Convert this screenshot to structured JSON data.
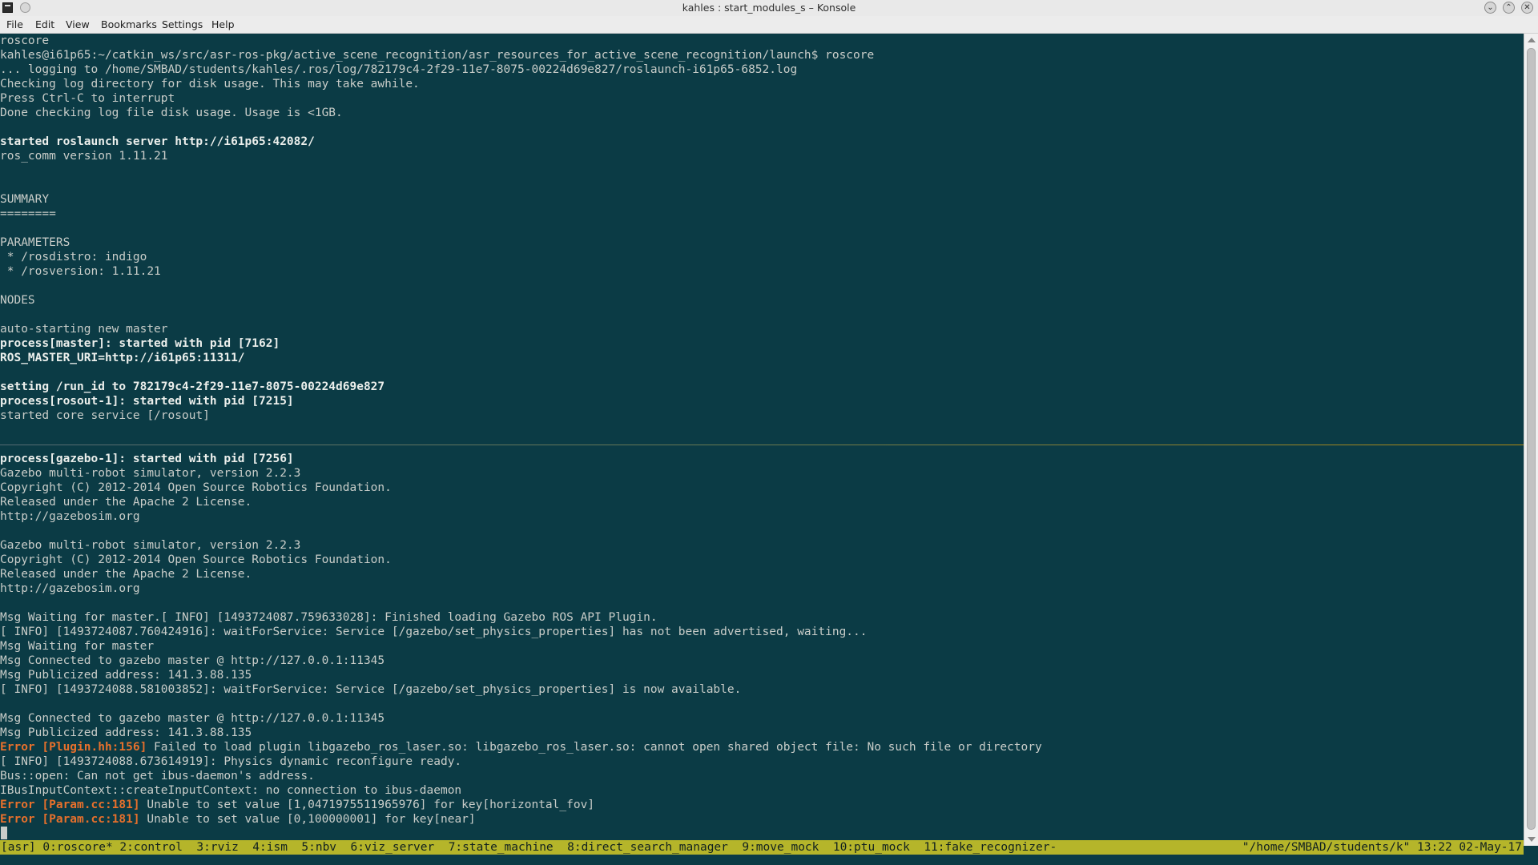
{
  "window": {
    "title": "kahles : start_modules_s – Konsole",
    "controls": {
      "minimize": "⌄",
      "maximize": "⌃",
      "close": "✕"
    }
  },
  "menubar": {
    "items": [
      "File",
      "Edit",
      "View",
      "Bookmarks",
      "Settings",
      "Help"
    ]
  },
  "terminal": {
    "lines": [
      {
        "text": "roscore",
        "style": "normal"
      },
      {
        "text": "kahles@i61p65:~/catkin_ws/src/asr-ros-pkg/active_scene_recognition/asr_resources_for_active_scene_recognition/launch$ roscore",
        "style": "normal"
      },
      {
        "text": "... logging to /home/SMBAD/students/kahles/.ros/log/782179c4-2f29-11e7-8075-00224d69e827/roslaunch-i61p65-6852.log",
        "style": "normal"
      },
      {
        "text": "Checking log directory for disk usage. This may take awhile.",
        "style": "normal"
      },
      {
        "text": "Press Ctrl-C to interrupt",
        "style": "normal"
      },
      {
        "text": "Done checking log file disk usage. Usage is <1GB.",
        "style": "normal"
      },
      {
        "text": "",
        "style": "normal"
      },
      {
        "text": "started roslaunch server http://i61p65:42082/",
        "style": "bold"
      },
      {
        "text": "ros_comm version 1.11.21",
        "style": "normal"
      },
      {
        "text": "",
        "style": "normal"
      },
      {
        "text": "",
        "style": "normal"
      },
      {
        "text": "SUMMARY",
        "style": "normal"
      },
      {
        "text": "========",
        "style": "normal"
      },
      {
        "text": "",
        "style": "normal"
      },
      {
        "text": "PARAMETERS",
        "style": "normal"
      },
      {
        "text": " * /rosdistro: indigo",
        "style": "normal"
      },
      {
        "text": " * /rosversion: 1.11.21",
        "style": "normal"
      },
      {
        "text": "",
        "style": "normal"
      },
      {
        "text": "NODES",
        "style": "normal"
      },
      {
        "text": "",
        "style": "normal"
      },
      {
        "text": "auto-starting new master",
        "style": "normal"
      },
      {
        "text": "process[master]: started with pid [7162]",
        "style": "bold"
      },
      {
        "text": "ROS_MASTER_URI=http://i61p65:11311/",
        "style": "bold"
      },
      {
        "text": "",
        "style": "normal"
      },
      {
        "text": "setting /run_id to 782179c4-2f29-11e7-8075-00224d69e827",
        "style": "bold"
      },
      {
        "text": "process[rosout-1]: started with pid [7215]",
        "style": "bold"
      },
      {
        "text": "started core service [/rosout]",
        "style": "normal"
      },
      {
        "text": "",
        "style": "normal"
      },
      {
        "text": "",
        "style": "normal"
      },
      {
        "text": "process[gazebo-1]: started with pid [7256]",
        "style": "bold"
      },
      {
        "text": "Gazebo multi-robot simulator, version 2.2.3",
        "style": "normal"
      },
      {
        "text": "Copyright (C) 2012-2014 Open Source Robotics Foundation.",
        "style": "normal"
      },
      {
        "text": "Released under the Apache 2 License.",
        "style": "normal"
      },
      {
        "text": "http://gazebosim.org",
        "style": "normal"
      },
      {
        "text": "",
        "style": "normal"
      },
      {
        "text": "Gazebo multi-robot simulator, version 2.2.3",
        "style": "normal"
      },
      {
        "text": "Copyright (C) 2012-2014 Open Source Robotics Foundation.",
        "style": "normal"
      },
      {
        "text": "Released under the Apache 2 License.",
        "style": "normal"
      },
      {
        "text": "http://gazebosim.org",
        "style": "normal"
      },
      {
        "text": "",
        "style": "normal"
      },
      {
        "text": "Msg Waiting for master.[ INFO] [1493724087.759633028]: Finished loading Gazebo ROS API Plugin.",
        "style": "normal"
      },
      {
        "text": "[ INFO] [1493724087.760424916]: waitForService: Service [/gazebo/set_physics_properties] has not been advertised, waiting...",
        "style": "normal"
      },
      {
        "text": "Msg Waiting for master",
        "style": "normal"
      },
      {
        "text": "Msg Connected to gazebo master @ http://127.0.0.1:11345",
        "style": "normal"
      },
      {
        "text": "Msg Publicized address: 141.3.88.135",
        "style": "normal"
      },
      {
        "text": "[ INFO] [1493724088.581003852]: waitForService: Service [/gazebo/set_physics_properties] is now available.",
        "style": "normal"
      },
      {
        "text": "",
        "style": "normal"
      },
      {
        "text": "Msg Connected to gazebo master @ http://127.0.0.1:11345",
        "style": "normal"
      },
      {
        "text": "Msg Publicized address: 141.3.88.135",
        "style": "normal"
      },
      {
        "text": "Failed to load plugin libgazebo_ros_laser.so: libgazebo_ros_laser.so: cannot open shared object file: No such file or directory",
        "style": "error",
        "prefix": "Error [Plugin.hh:156]"
      },
      {
        "text": "[ INFO] [1493724088.673614919]: Physics dynamic reconfigure ready.",
        "style": "normal"
      },
      {
        "text": "Bus::open: Can not get ibus-daemon's address.",
        "style": "normal"
      },
      {
        "text": "IBusInputContext::createInputContext: no connection to ibus-daemon",
        "style": "normal"
      },
      {
        "text": "Unable to set value [1,0471975511965976] for key[horizontal_fov]",
        "style": "error",
        "prefix": "Error [Param.cc:181]"
      },
      {
        "text": "Unable to set value [0,100000001] for key[near]",
        "style": "error",
        "prefix": "Error [Param.cc:181]"
      }
    ]
  },
  "statusbar": {
    "left": "[asr] 0:roscore* 2:control  3:rviz  4:ism  5:nbv  6:viz_server  7:state_machine  8:direct_search_manager  9:move_mock  10:ptu_mock  11:fake_recognizer-",
    "right": "\"/home/SMBAD/students/k\" 13:22 02-May-17"
  },
  "colors": {
    "background": "#0b3b45",
    "foreground": "#c9cdc9",
    "error": "#e7702c",
    "statusbar": "#b5b52a"
  }
}
